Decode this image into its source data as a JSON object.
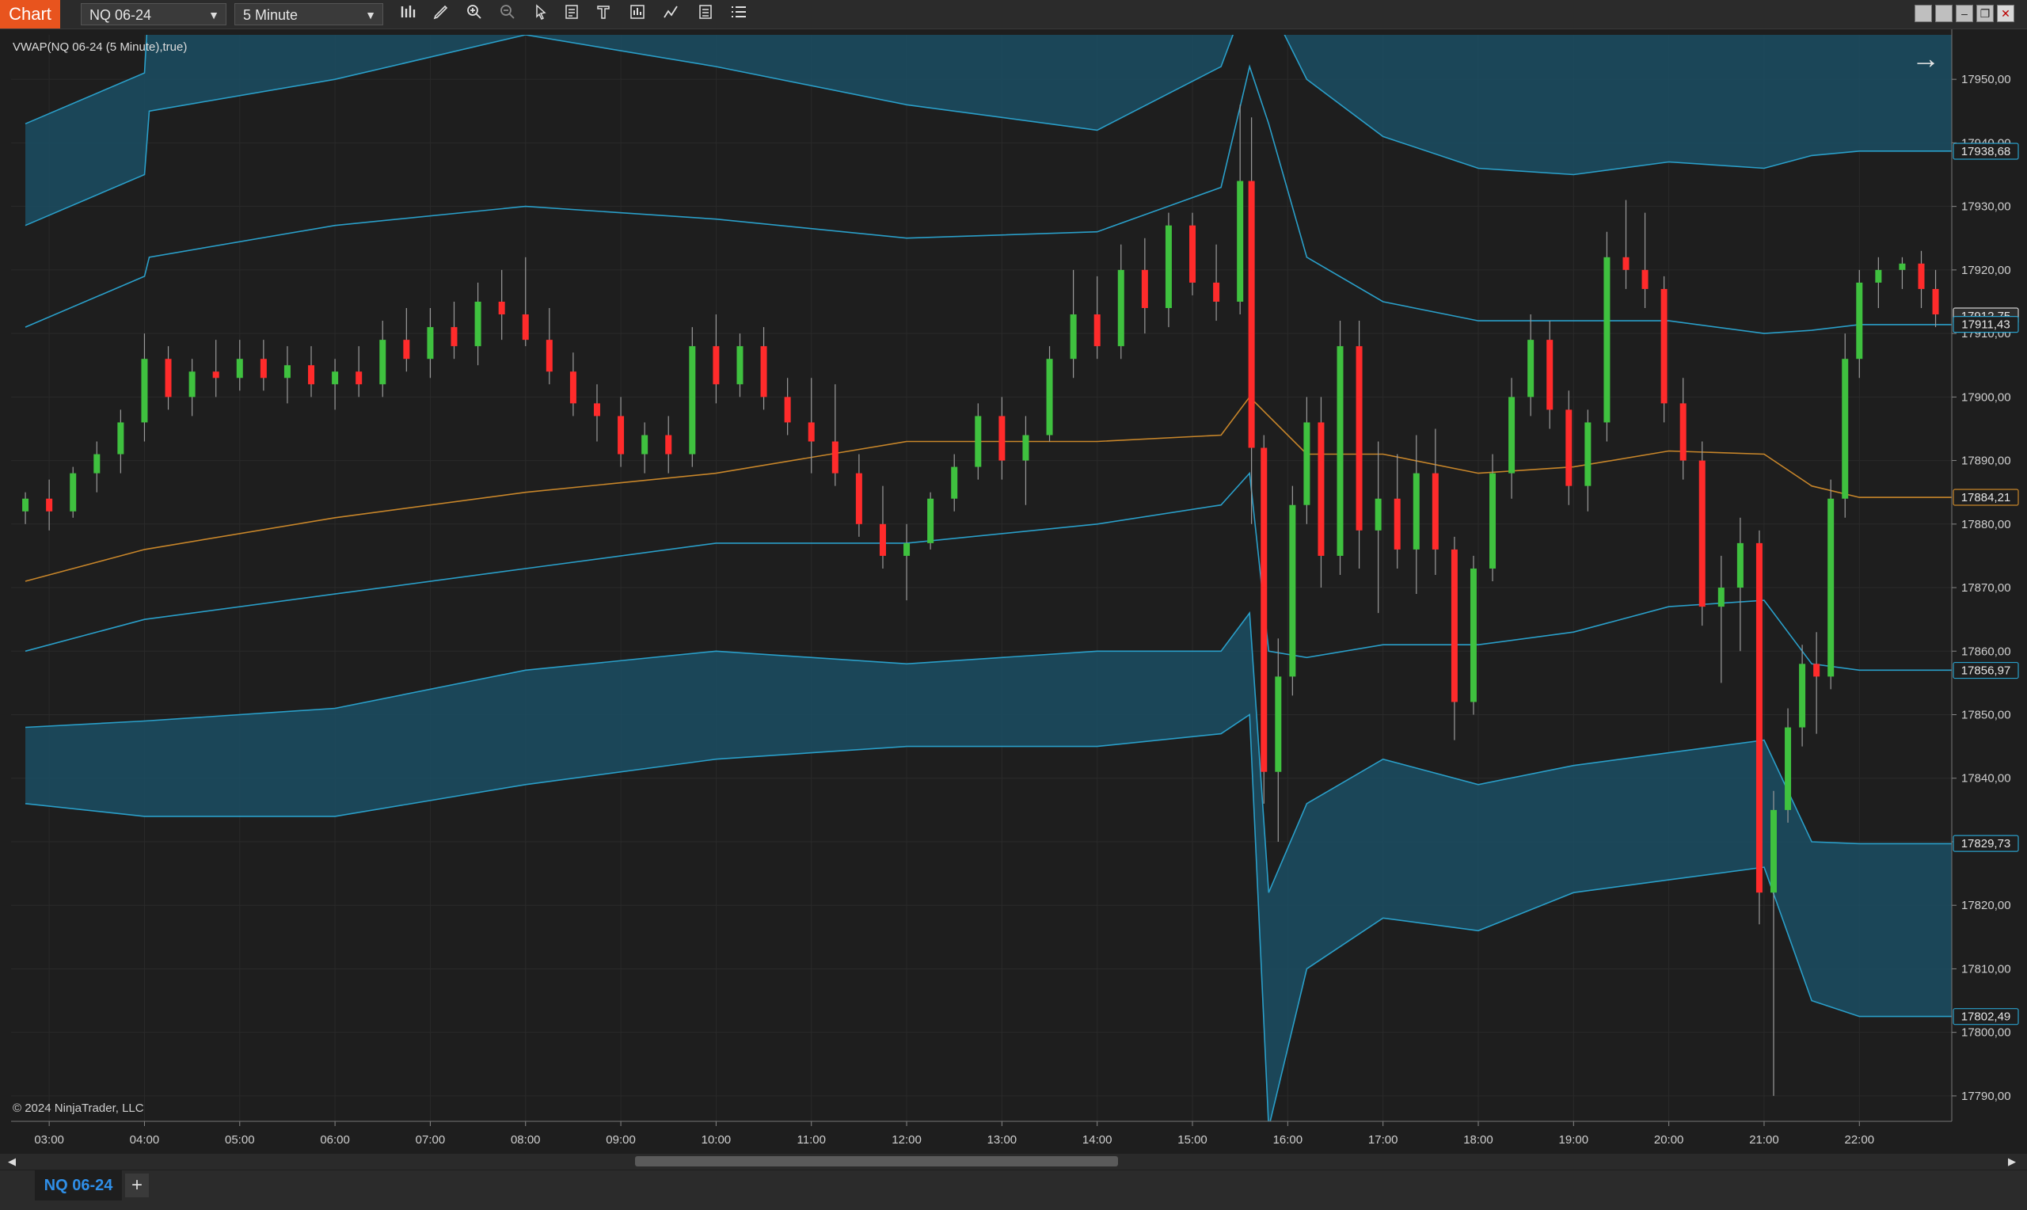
{
  "window": {
    "app_title": "Chart",
    "instrument": "NQ 06-24",
    "interval": "5 Minute"
  },
  "toolbar": {
    "icons": [
      "bar-type-icon",
      "draw-pencil-icon",
      "zoom-in-icon",
      "zoom-out-icon",
      "pointer-icon",
      "data-box-icon",
      "templates-icon",
      "strategies-icon",
      "indicators-icon",
      "properties-icon",
      "list-icon"
    ]
  },
  "window_controls": [
    "tile-icon",
    "restore-down-icon",
    "minimize-icon",
    "maximize-icon",
    "close-icon"
  ],
  "indicator_label": "VWAP(NQ 06-24 (5 Minute),true)",
  "copyright": "© 2024 NinjaTrader, LLC",
  "tab": {
    "active_label": "NQ 06-24",
    "add_label": "+"
  },
  "colors": {
    "background": "#1e1e1e",
    "up_candle": "#3fc13f",
    "down_candle": "#ff2b2b",
    "band_fill": "#1b4d63",
    "band_line": "#2a9fc9",
    "vwap_line": "#c8862a",
    "accent": "#e8541e",
    "tab_text": "#2f8fe8"
  },
  "chart_data": {
    "type": "candlestick",
    "x_ticks": [
      "03:00",
      "04:00",
      "05:00",
      "06:00",
      "07:00",
      "08:00",
      "09:00",
      "10:00",
      "11:00",
      "12:00",
      "13:00",
      "14:00",
      "15:00",
      "16:00",
      "17:00",
      "18:00",
      "19:00",
      "20:00",
      "21:00",
      "22:00"
    ],
    "y_ticks": [
      "17950,00",
      "17940,00",
      "17930,00",
      "17920,00",
      "17910,00",
      "17900,00",
      "17890,00",
      "17880,00",
      "17870,00",
      "17860,00",
      "17850,00",
      "17840,00",
      "17830,00",
      "17820,00",
      "17810,00",
      "17800,00",
      "17790,00"
    ],
    "ylim": [
      17786,
      17957
    ],
    "price_markers": [
      {
        "label": "17938,68",
        "value": 17938.68,
        "style": "band"
      },
      {
        "label": "17912,75",
        "value": 17912.75,
        "style": "last"
      },
      {
        "label": "17911,43",
        "value": 17911.43,
        "style": "band"
      },
      {
        "label": "17884,21",
        "value": 17884.21,
        "style": "vwap"
      },
      {
        "label": "17856,97",
        "value": 17856.97,
        "style": "band"
      },
      {
        "label": "17829,73",
        "value": 17829.73,
        "style": "band"
      },
      {
        "label": "17802,49",
        "value": 17802.49,
        "style": "band"
      }
    ],
    "xlim_hours": [
      2.6,
      22.97
    ],
    "vwap": [
      [
        2.75,
        17871
      ],
      [
        4,
        17876
      ],
      [
        6,
        17881
      ],
      [
        8,
        17885
      ],
      [
        10,
        17888
      ],
      [
        12,
        17893
      ],
      [
        14,
        17893
      ],
      [
        15.3,
        17894
      ],
      [
        15.6,
        17900
      ],
      [
        15.8,
        17897
      ],
      [
        16.2,
        17891
      ],
      [
        17,
        17891
      ],
      [
        18,
        17888
      ],
      [
        19,
        17889
      ],
      [
        20,
        17891.5
      ],
      [
        21,
        17891
      ],
      [
        21.5,
        17886
      ],
      [
        22,
        17884.2
      ],
      [
        22.97,
        17884.2
      ]
    ],
    "band_sd": [
      [
        2.75,
        17911
      ],
      [
        4,
        17919
      ],
      [
        4.05,
        17922
      ],
      [
        6,
        17927
      ],
      [
        8,
        17930
      ],
      [
        10,
        17928
      ],
      [
        12,
        17925
      ],
      [
        14,
        17926
      ],
      [
        15.3,
        17933
      ],
      [
        15.6,
        17952
      ],
      [
        15.8,
        17943
      ],
      [
        16.2,
        17922
      ],
      [
        17,
        17915
      ],
      [
        18,
        17912
      ],
      [
        19,
        17912
      ],
      [
        20,
        17912
      ],
      [
        21,
        17910
      ],
      [
        21.5,
        17910.5
      ],
      [
        22,
        17911.4
      ],
      [
        22.97,
        17911.4
      ]
    ],
    "band_2sd": [
      [
        2.75,
        17927
      ],
      [
        4,
        17935
      ],
      [
        4.05,
        17945
      ],
      [
        6,
        17950
      ],
      [
        8,
        17957
      ],
      [
        10,
        17952
      ],
      [
        12,
        17946
      ],
      [
        14,
        17942
      ],
      [
        15.3,
        17952
      ],
      [
        15.55,
        17962
      ],
      [
        15.8,
        17962
      ],
      [
        16.2,
        17950
      ],
      [
        17,
        17941
      ],
      [
        18,
        17936
      ],
      [
        19,
        17935
      ],
      [
        20,
        17937
      ],
      [
        21,
        17936
      ],
      [
        21.5,
        17938
      ],
      [
        22,
        17938.7
      ],
      [
        22.97,
        17938.7
      ]
    ],
    "band_3sd": [
      [
        2.75,
        17943
      ],
      [
        4,
        17951
      ],
      [
        4.05,
        17964
      ],
      [
        6,
        17972
      ],
      [
        8,
        17980
      ],
      [
        10,
        17975
      ],
      [
        12,
        17970
      ],
      [
        14,
        17965
      ],
      [
        15.3,
        17970
      ],
      [
        15.55,
        17975
      ],
      [
        15.8,
        17975
      ],
      [
        16.2,
        17970
      ],
      [
        17,
        17968
      ],
      [
        18,
        17962
      ],
      [
        19,
        17963
      ],
      [
        20,
        17964
      ],
      [
        21,
        17962
      ],
      [
        21.5,
        17965
      ],
      [
        22,
        17966
      ],
      [
        22.97,
        17966
      ]
    ],
    "band_minus_1": [
      [
        2.75,
        17860
      ],
      [
        4,
        17865
      ],
      [
        6,
        17869
      ],
      [
        8,
        17873
      ],
      [
        10,
        17877
      ],
      [
        12,
        17877
      ],
      [
        14,
        17880
      ],
      [
        15.3,
        17883
      ],
      [
        15.6,
        17888
      ],
      [
        15.8,
        17860
      ],
      [
        16.2,
        17859
      ],
      [
        17,
        17861
      ],
      [
        18,
        17861
      ],
      [
        19,
        17863
      ],
      [
        20,
        17867
      ],
      [
        21,
        17868
      ],
      [
        21.5,
        17858
      ],
      [
        22,
        17857
      ],
      [
        22.97,
        17857
      ]
    ],
    "band_minus_2": [
      [
        2.75,
        17848
      ],
      [
        4,
        17849
      ],
      [
        6,
        17851
      ],
      [
        8,
        17857
      ],
      [
        10,
        17860
      ],
      [
        12,
        17858
      ],
      [
        14,
        17860
      ],
      [
        15.3,
        17860
      ],
      [
        15.6,
        17866
      ],
      [
        15.8,
        17822
      ],
      [
        16.2,
        17836
      ],
      [
        17,
        17843
      ],
      [
        18,
        17839
      ],
      [
        19,
        17842
      ],
      [
        20,
        17844
      ],
      [
        21,
        17846
      ],
      [
        21.5,
        17830
      ],
      [
        22,
        17829.7
      ],
      [
        22.97,
        17829.7
      ]
    ],
    "band_minus_3": [
      [
        2.75,
        17836
      ],
      [
        4,
        17834
      ],
      [
        6,
        17834
      ],
      [
        8,
        17839
      ],
      [
        10,
        17843
      ],
      [
        12,
        17845
      ],
      [
        14,
        17845
      ],
      [
        15.3,
        17847
      ],
      [
        15.6,
        17850
      ],
      [
        15.8,
        17785
      ],
      [
        16.2,
        17810
      ],
      [
        17,
        17818
      ],
      [
        18,
        17816
      ],
      [
        19,
        17822
      ],
      [
        20,
        17824
      ],
      [
        21,
        17826
      ],
      [
        21.5,
        17805
      ],
      [
        22,
        17802.5
      ],
      [
        22.97,
        17802.5
      ]
    ],
    "candles": [
      [
        2.75,
        17882,
        17885,
        17880,
        17884
      ],
      [
        3.0,
        17884,
        17887,
        17879,
        17882
      ],
      [
        3.25,
        17882,
        17889,
        17881,
        17888
      ],
      [
        3.5,
        17888,
        17893,
        17885,
        17891
      ],
      [
        3.75,
        17891,
        17898,
        17888,
        17896
      ],
      [
        4.0,
        17896,
        17910,
        17893,
        17906
      ],
      [
        4.25,
        17906,
        17908,
        17898,
        17900
      ],
      [
        4.5,
        17900,
        17906,
        17897,
        17904
      ],
      [
        4.75,
        17904,
        17909,
        17900,
        17903
      ],
      [
        5.0,
        17903,
        17909,
        17901,
        17906
      ],
      [
        5.25,
        17906,
        17909,
        17901,
        17903
      ],
      [
        5.5,
        17903,
        17908,
        17899,
        17905
      ],
      [
        5.75,
        17905,
        17908,
        17900,
        17902
      ],
      [
        6.0,
        17902,
        17906,
        17898,
        17904
      ],
      [
        6.25,
        17904,
        17908,
        17900,
        17902
      ],
      [
        6.5,
        17902,
        17912,
        17900,
        17909
      ],
      [
        6.75,
        17909,
        17914,
        17904,
        17906
      ],
      [
        7.0,
        17906,
        17914,
        17903,
        17911
      ],
      [
        7.25,
        17911,
        17915,
        17906,
        17908
      ],
      [
        7.5,
        17908,
        17918,
        17905,
        17915
      ],
      [
        7.75,
        17915,
        17920,
        17909,
        17913
      ],
      [
        8.0,
        17913,
        17922,
        17908,
        17909
      ],
      [
        8.25,
        17909,
        17914,
        17902,
        17904
      ],
      [
        8.5,
        17904,
        17907,
        17897,
        17899
      ],
      [
        8.75,
        17899,
        17902,
        17893,
        17897
      ],
      [
        9.0,
        17897,
        17900,
        17889,
        17891
      ],
      [
        9.25,
        17891,
        17896,
        17888,
        17894
      ],
      [
        9.5,
        17894,
        17897,
        17888,
        17891
      ],
      [
        9.75,
        17891,
        17911,
        17889,
        17908
      ],
      [
        10.0,
        17908,
        17913,
        17899,
        17902
      ],
      [
        10.25,
        17902,
        17910,
        17900,
        17908
      ],
      [
        10.5,
        17908,
        17911,
        17898,
        17900
      ],
      [
        10.75,
        17900,
        17903,
        17894,
        17896
      ],
      [
        11.0,
        17896,
        17903,
        17888,
        17893
      ],
      [
        11.25,
        17893,
        17902,
        17886,
        17888
      ],
      [
        11.5,
        17888,
        17891,
        17878,
        17880
      ],
      [
        11.75,
        17880,
        17886,
        17873,
        17875
      ],
      [
        12.0,
        17875,
        17880,
        17868,
        17877
      ],
      [
        12.25,
        17877,
        17885,
        17876,
        17884
      ],
      [
        12.5,
        17884,
        17891,
        17882,
        17889
      ],
      [
        12.75,
        17889,
        17899,
        17887,
        17897
      ],
      [
        13.0,
        17897,
        17900,
        17887,
        17890
      ],
      [
        13.25,
        17890,
        17897,
        17883,
        17894
      ],
      [
        13.5,
        17894,
        17908,
        17893,
        17906
      ],
      [
        13.75,
        17906,
        17920,
        17903,
        17913
      ],
      [
        14.0,
        17913,
        17919,
        17906,
        17908
      ],
      [
        14.25,
        17908,
        17924,
        17906,
        17920
      ],
      [
        14.5,
        17920,
        17925,
        17910,
        17914
      ],
      [
        14.75,
        17914,
        17929,
        17911,
        17927
      ],
      [
        15.0,
        17927,
        17929,
        17916,
        17918
      ],
      [
        15.25,
        17918,
        17924,
        17912,
        17915
      ],
      [
        15.5,
        17915,
        17946,
        17913,
        17934
      ],
      [
        15.62,
        17934,
        17944,
        17880,
        17892
      ],
      [
        15.75,
        17892,
        17894,
        17836,
        17841
      ],
      [
        15.9,
        17841,
        17862,
        17830,
        17856
      ],
      [
        16.05,
        17856,
        17886,
        17853,
        17883
      ],
      [
        16.2,
        17883,
        17900,
        17880,
        17896
      ],
      [
        16.35,
        17896,
        17900,
        17870,
        17875
      ],
      [
        16.55,
        17875,
        17912,
        17872,
        17908
      ],
      [
        16.75,
        17908,
        17912,
        17873,
        17879
      ],
      [
        16.95,
        17879,
        17893,
        17866,
        17884
      ],
      [
        17.15,
        17884,
        17891,
        17873,
        17876
      ],
      [
        17.35,
        17876,
        17894,
        17869,
        17888
      ],
      [
        17.55,
        17888,
        17895,
        17872,
        17876
      ],
      [
        17.75,
        17876,
        17878,
        17846,
        17852
      ],
      [
        17.95,
        17852,
        17875,
        17850,
        17873
      ],
      [
        18.15,
        17873,
        17891,
        17871,
        17888
      ],
      [
        18.35,
        17888,
        17903,
        17884,
        17900
      ],
      [
        18.55,
        17900,
        17913,
        17897,
        17909
      ],
      [
        18.75,
        17909,
        17912,
        17895,
        17898
      ],
      [
        18.95,
        17898,
        17901,
        17883,
        17886
      ],
      [
        19.15,
        17886,
        17898,
        17882,
        17896
      ],
      [
        19.35,
        17896,
        17926,
        17893,
        17922
      ],
      [
        19.55,
        17922,
        17931,
        17917,
        17920
      ],
      [
        19.75,
        17920,
        17929,
        17914,
        17917
      ],
      [
        19.95,
        17917,
        17919,
        17896,
        17899
      ],
      [
        20.15,
        17899,
        17903,
        17887,
        17890
      ],
      [
        20.35,
        17890,
        17893,
        17864,
        17867
      ],
      [
        20.55,
        17867,
        17875,
        17855,
        17870
      ],
      [
        20.75,
        17870,
        17881,
        17860,
        17877
      ],
      [
        20.95,
        17877,
        17879,
        17817,
        17822
      ],
      [
        21.1,
        17822,
        17838,
        17790,
        17835
      ],
      [
        21.25,
        17835,
        17851,
        17833,
        17848
      ],
      [
        21.4,
        17848,
        17861,
        17845,
        17858
      ],
      [
        21.55,
        17858,
        17863,
        17847,
        17856
      ],
      [
        21.7,
        17856,
        17887,
        17854,
        17884
      ],
      [
        21.85,
        17884,
        17910,
        17881,
        17906
      ],
      [
        22.0,
        17906,
        17920,
        17903,
        17918
      ],
      [
        22.2,
        17918,
        17922,
        17914,
        17920
      ],
      [
        22.45,
        17920,
        17922,
        17917,
        17921
      ],
      [
        22.65,
        17921,
        17923,
        17914,
        17917
      ],
      [
        22.8,
        17917,
        17920,
        17911,
        17913
      ]
    ]
  }
}
